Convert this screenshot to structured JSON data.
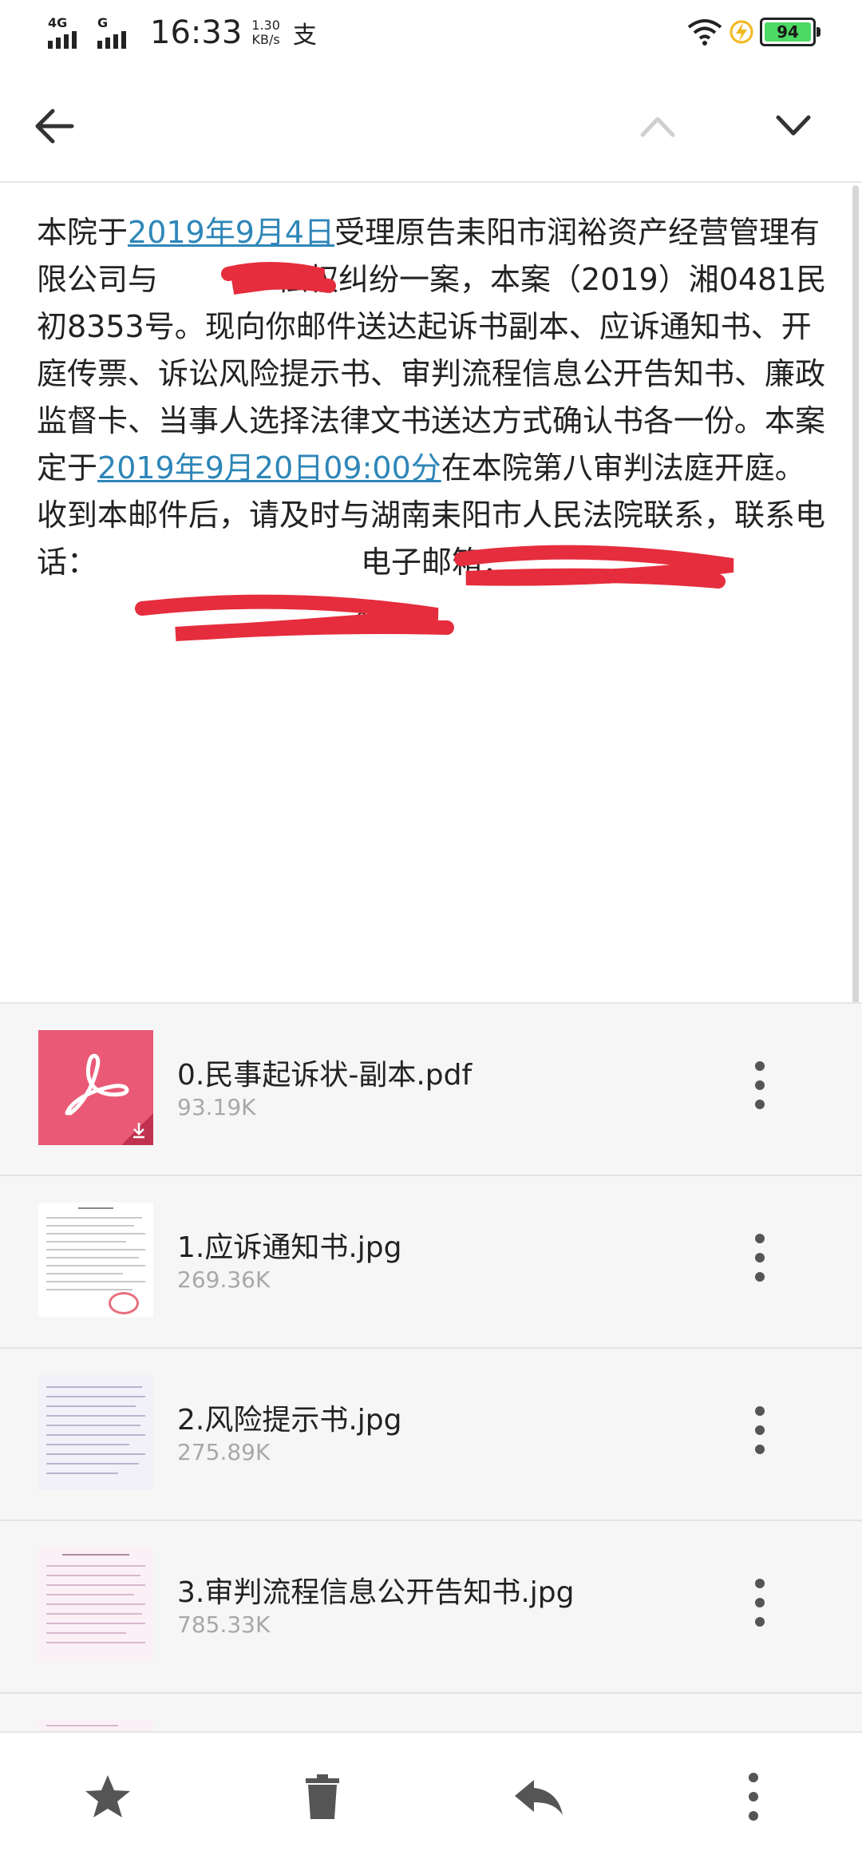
{
  "status_bar": {
    "net1": "4G",
    "net2": "G",
    "time": "16:33",
    "speed_value": "1.30",
    "speed_unit": "KB/s",
    "app_icon": "alipay-icon",
    "battery": "94",
    "accent_color": "#4cd964"
  },
  "toolbar": {
    "back_icon": "arrow-left-icon",
    "prev_icon": "chevron-up-icon",
    "next_icon": "chevron-down-icon"
  },
  "body": {
    "t1": "本院于",
    "date_link": "2019年9月4日",
    "t2": "受理原告耒阳市润裕资产经营管理有限公司与",
    "t3": "偿权纠纷一案，本案（2019）湘0481民初8353号。现向你邮件送达起诉书副本、应诉通知书、开庭传票、诉讼风险提示书、审判流程信息公开告知书、廉政监督卡、当事人选择法律文书送达方式确认书各一份。本案定于",
    "hearing_link": "2019年9月20日09:00分",
    "t4": "在本院第八审判法庭开庭。收到本邮件后，请及时与湖南耒阳市人民法院联系，联系电话：",
    "t5": "电子邮箱：",
    "t6": "。",
    "link_color": "#2e86b8"
  },
  "attachments": [
    {
      "name": "0.民事起诉状-副本.pdf",
      "size": "93.19K",
      "type": "pdf"
    },
    {
      "name": "1.应诉通知书.jpg",
      "size": "269.36K",
      "type": "image"
    },
    {
      "name": "2.风险提示书.jpg",
      "size": "275.89K",
      "type": "image"
    },
    {
      "name": "3.审判流程信息公开告知书.jpg",
      "size": "785.33K",
      "type": "image"
    }
  ],
  "bottom_bar": {
    "star_icon": "star-icon",
    "delete_icon": "trash-icon",
    "reply_icon": "reply-icon",
    "more_icon": "more-vertical-icon"
  },
  "pdf_color": "#ea5a76"
}
